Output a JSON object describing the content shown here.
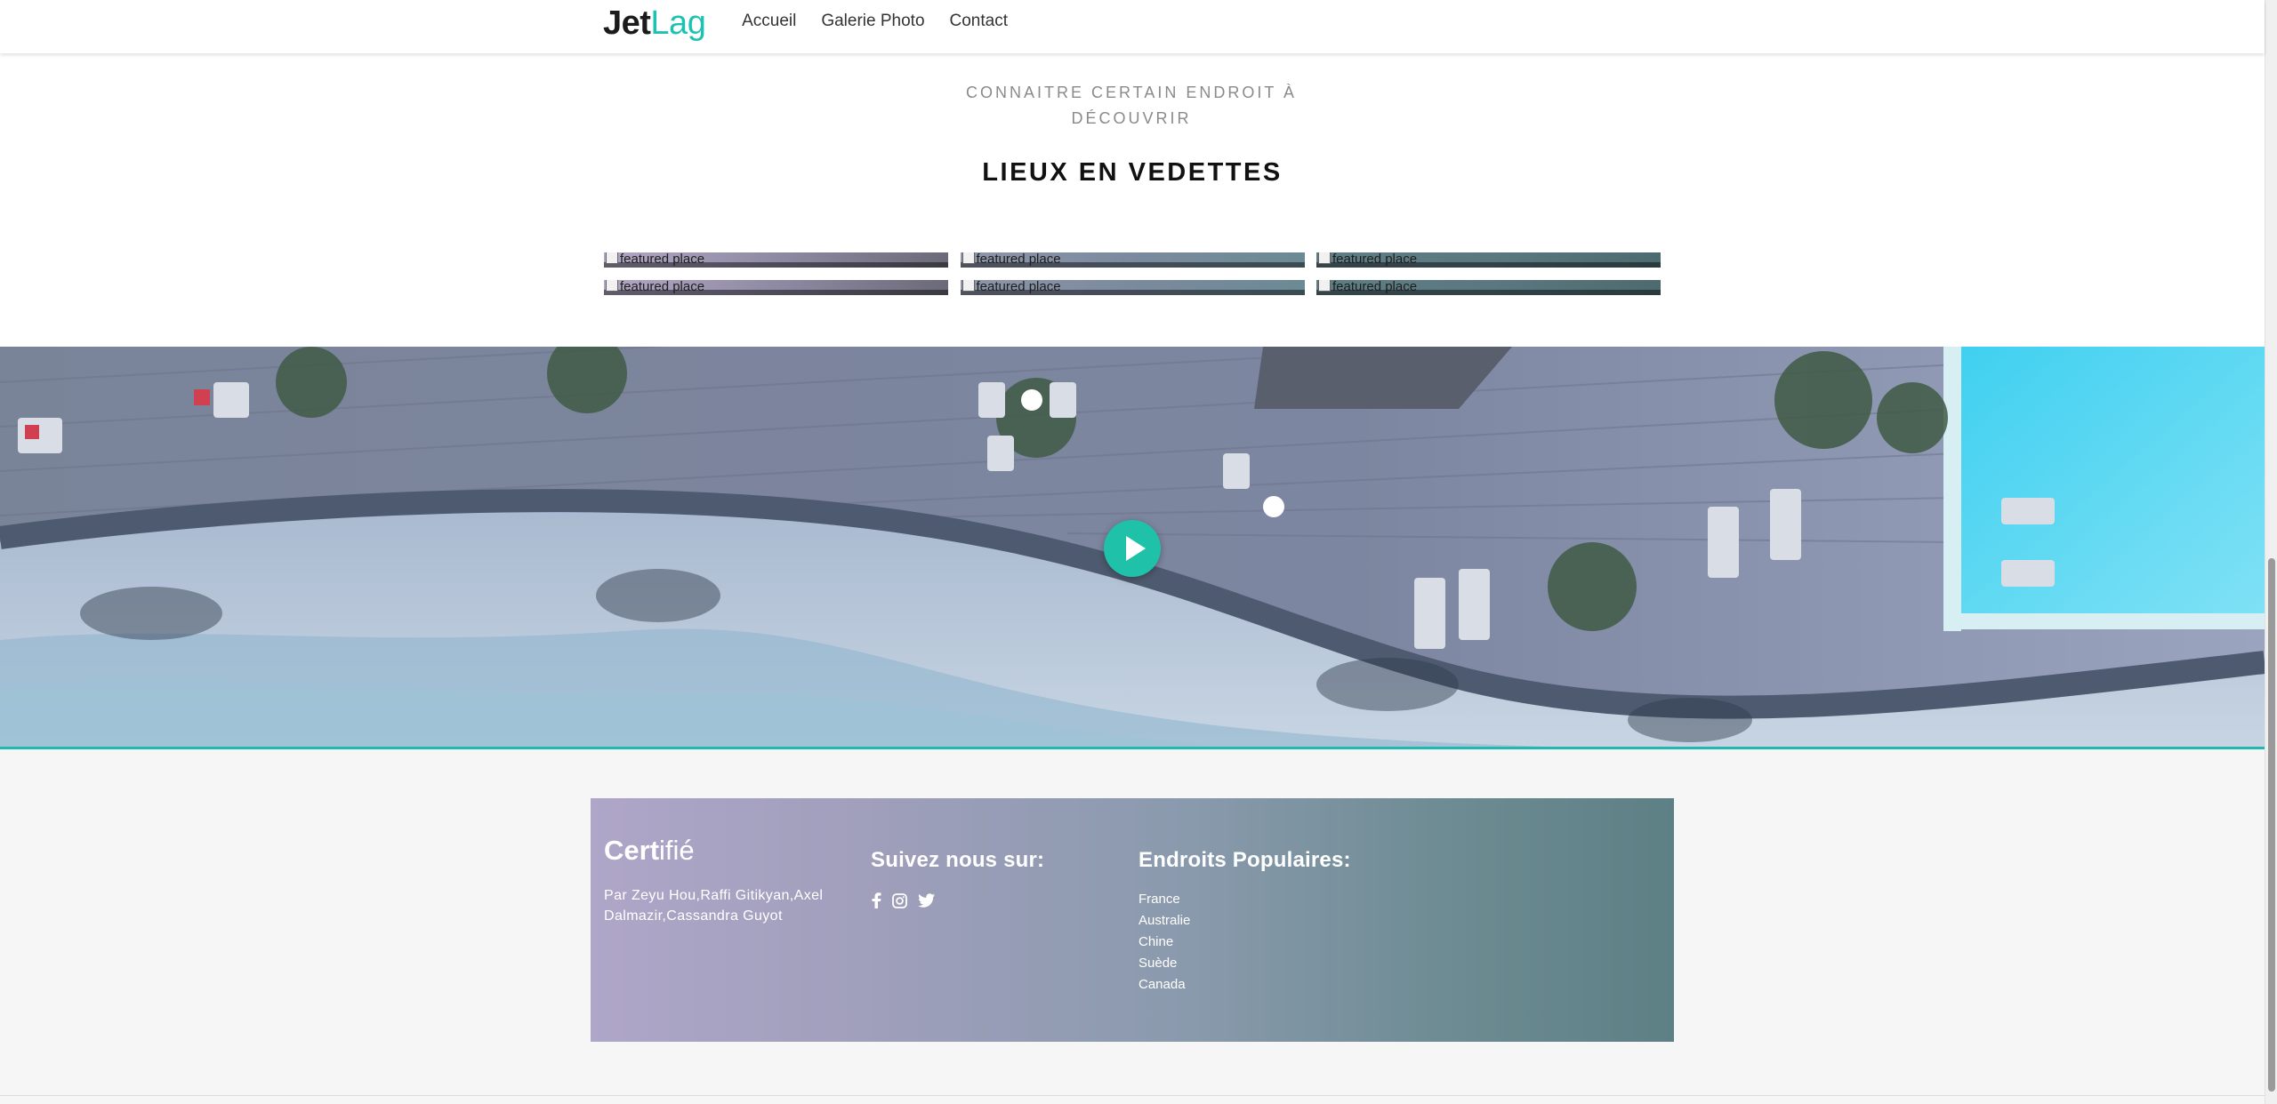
{
  "header": {
    "logo_bold": "Jet",
    "logo_light": "Lag",
    "nav": [
      "Accueil",
      "Galerie Photo",
      "Contact"
    ]
  },
  "featured": {
    "subtitle": "CONNAITRE CERTAIN ENDROIT À DÉCOUVRIR",
    "heading": "LIEUX EN VEDETTES",
    "tiles": [
      "featured place",
      "featured place",
      "featured place",
      "featured place",
      "featured place",
      "featured place"
    ]
  },
  "video": {
    "play_icon": "play-icon"
  },
  "footer": {
    "brand_bold": "Cert",
    "brand_light": "ifié",
    "credits": "Par Zeyu Hou,Raffi Gitikyan,Axel Dalmazir,Cassandra Guyot",
    "social_title": "Suivez nous sur:",
    "social_icons": [
      "facebook-icon",
      "instagram-icon",
      "twitter-icon"
    ],
    "places_title": "Endroits Populaires:",
    "places": [
      "France",
      "Australie",
      "Chine",
      "Suède",
      "Canada"
    ]
  },
  "colors": {
    "accent": "#1ec2b3",
    "play": "#20c1a9"
  }
}
